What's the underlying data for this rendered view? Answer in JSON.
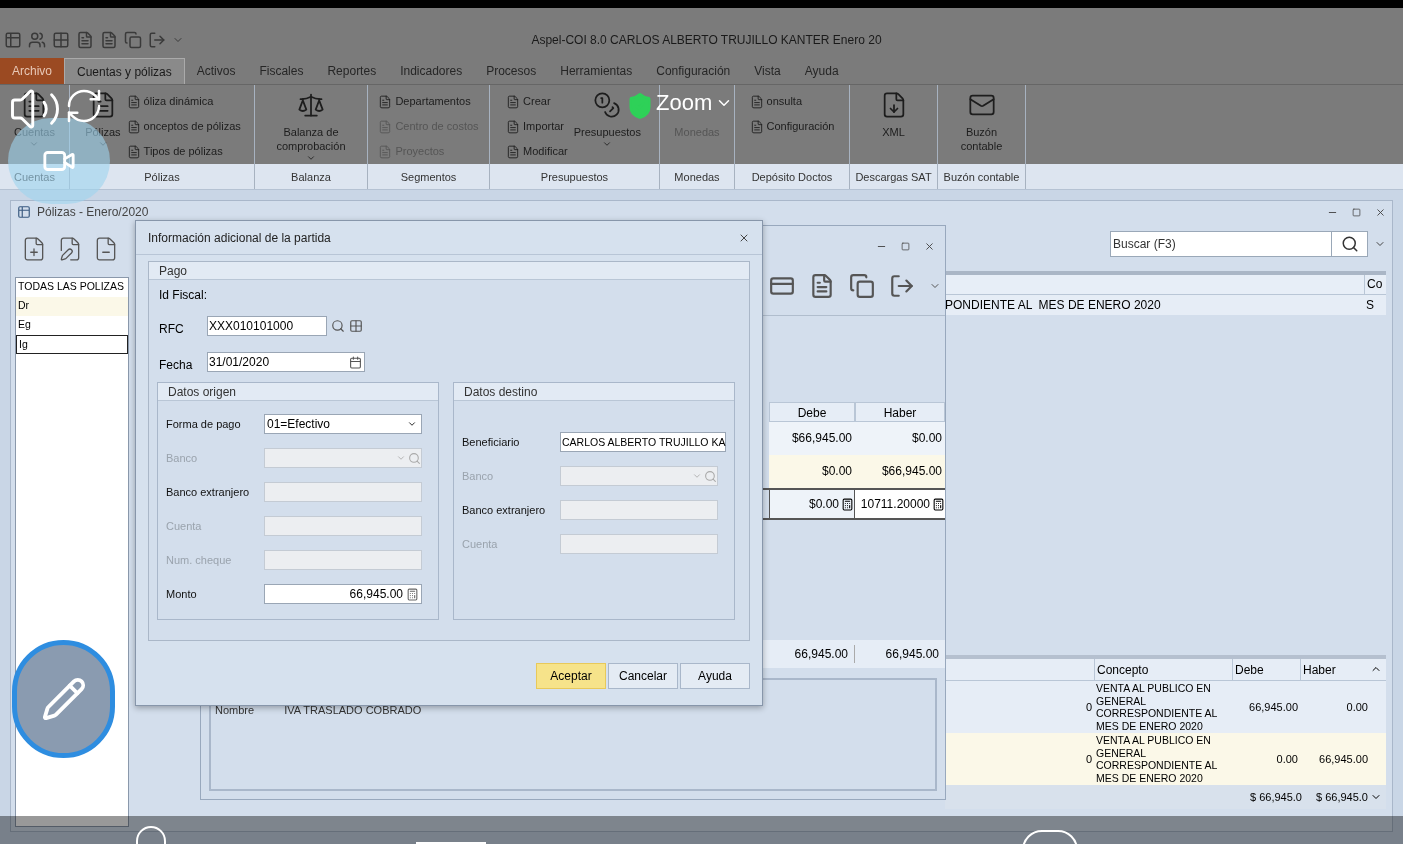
{
  "window": {
    "title": "Aspel-COI 8.0 CARLOS ALBERTO TRUJILLO KANTER Enero 20"
  },
  "menu_tabs": [
    {
      "label": "Archivo",
      "kind": "file",
      "selected": false
    },
    {
      "label": "Cuentas y pólizas",
      "kind": "tab",
      "selected": true
    },
    {
      "label": "Activos",
      "kind": "tab",
      "selected": false
    },
    {
      "label": "Fiscales",
      "kind": "tab",
      "selected": false
    },
    {
      "label": "Reportes",
      "kind": "tab",
      "selected": false
    },
    {
      "label": "Indicadores",
      "kind": "tab",
      "selected": false
    },
    {
      "label": "Procesos",
      "kind": "tab",
      "selected": false
    },
    {
      "label": "Herramientas",
      "kind": "tab",
      "selected": false
    },
    {
      "label": "Configuración",
      "kind": "tab",
      "selected": false
    },
    {
      "label": "Vista",
      "kind": "tab",
      "selected": false
    },
    {
      "label": "Ayuda",
      "kind": "tab",
      "selected": false
    }
  ],
  "ribbon_groups": [
    {
      "label": "Cuentas",
      "items": [
        {
          "label": "Cuentas",
          "kind": "large",
          "disabled": false,
          "dropdown": true
        }
      ]
    },
    {
      "label": "Pólizas",
      "items": [
        {
          "label": "Pólizas",
          "kind": "large",
          "disabled": false,
          "dropdown": true
        },
        {
          "label": "óliza dinámica",
          "kind": "small",
          "disabled": false
        },
        {
          "label": "onceptos de pólizas",
          "kind": "small",
          "disabled": false
        },
        {
          "label": "Tipos de pólizas",
          "kind": "small",
          "disabled": false
        }
      ]
    },
    {
      "label": "Balanza",
      "items": [
        {
          "label": "Balanza de comprobación",
          "kind": "large",
          "disabled": false,
          "dropdown": true
        }
      ]
    },
    {
      "label": "Segmentos",
      "items": [
        {
          "label": "Departamentos",
          "kind": "small",
          "disabled": false
        },
        {
          "label": "Centro de costos",
          "kind": "small",
          "disabled": true
        },
        {
          "label": "Proyectos",
          "kind": "small",
          "disabled": true
        }
      ]
    },
    {
      "label": "Presupuestos",
      "items": [
        {
          "label": "Crear",
          "kind": "small",
          "disabled": false
        },
        {
          "label": "Importar",
          "kind": "small",
          "disabled": false
        },
        {
          "label": "Modificar",
          "kind": "small",
          "disabled": false
        },
        {
          "label": "Presupuestos",
          "kind": "large",
          "disabled": false,
          "dropdown": true
        }
      ]
    },
    {
      "label": "Monedas",
      "items": [
        {
          "label": "Monedas",
          "kind": "large",
          "disabled": true,
          "dropdown": false
        }
      ]
    },
    {
      "label": "Depósito Doctos",
      "items": [
        {
          "label": "onsulta",
          "kind": "small",
          "disabled": false
        },
        {
          "label": "Configuración",
          "kind": "small",
          "disabled": false
        }
      ]
    },
    {
      "label": "Descargas SAT",
      "items": [
        {
          "label": "XML",
          "kind": "large",
          "disabled": false,
          "dropdown": false
        }
      ]
    },
    {
      "label": "Buzón contable",
      "items": [
        {
          "label": "Buzón contable",
          "kind": "large",
          "disabled": false,
          "dropdown": false
        }
      ]
    }
  ],
  "polizas_window": {
    "title": "Pólizas - Enero/2020",
    "types": [
      {
        "label": "TODAS LAS POLIZAS",
        "selected": false
      },
      {
        "label": "Dr",
        "selected": false
      },
      {
        "label": "Eg",
        "selected": false
      },
      {
        "label": "Ig",
        "selected": true
      }
    ],
    "search": {
      "placeholder": "Buscar (F3)"
    },
    "table": {
      "columns": [
        "Co"
      ],
      "rows": [
        {
          "concepto": "PONDIENTE AL  MES DE ENERO 2020",
          "column_2": "S"
        }
      ]
    },
    "detail_grid": {
      "columns": [
        "Concepto",
        "Debe",
        "Haber"
      ],
      "rows": [
        {
          "column_1": "0",
          "concepto": "VENTA AL PUBLICO EN GENERAL CORRESPONDIENTE AL MES DE ENERO 2020",
          "debe": "66,945.00",
          "haber": "0.00"
        },
        {
          "column_1": "0",
          "concepto": "VENTA AL PUBLICO EN GENERAL CORRESPONDIENTE AL MES DE ENERO 2020",
          "debe": "0.00",
          "haber": "66,945.00"
        }
      ],
      "totals": [
        "$ 66,945.0",
        "$ 66,945.0"
      ]
    }
  },
  "movimientos_window": {
    "columns": [
      "Debe",
      "Haber"
    ],
    "rows": [
      {
        "debe": "$66,945.00",
        "haber": "$0.00"
      },
      {
        "debe": "$0.00",
        "haber": "$66,945.00"
      }
    ],
    "edit_row": {
      "debe": "$0.00",
      "haber": "10711.20000"
    },
    "totals": {
      "debe": "66,945.00",
      "haber": "66,945.00"
    },
    "account": {
      "label": "Nombre",
      "value": "IVA TRASLADO COBRADO"
    }
  },
  "dialog": {
    "title": "Información adicional de la partida",
    "section": "Pago",
    "id_fiscal": "Id Fiscal:",
    "rfc": {
      "label": "RFC",
      "value": "XXX010101000"
    },
    "fecha": {
      "label": "Fecha",
      "value": "31/01/2020"
    },
    "origen": {
      "title": "Datos origen",
      "fields": [
        {
          "label": "Forma de pago",
          "kind": "select",
          "value": "01=Efectivo",
          "disabled": false
        },
        {
          "label": "Banco",
          "kind": "lookup",
          "disabled": true
        },
        {
          "label": "Banco extranjero",
          "kind": "text",
          "disabled": false
        },
        {
          "label": "Cuenta",
          "kind": "text",
          "disabled": true
        },
        {
          "label": "Num. cheque",
          "kind": "text",
          "disabled": true
        },
        {
          "label": "Monto",
          "kind": "amount",
          "value": "66,945.00",
          "disabled": false
        }
      ]
    },
    "destino": {
      "title": "Datos destino",
      "fields": [
        {
          "label": "Beneficiario",
          "kind": "text",
          "value": "CARLOS ALBERTO TRUJILLO KA",
          "disabled": false
        },
        {
          "label": "Banco",
          "kind": "lookup",
          "disabled": true
        },
        {
          "label": "Banco extranjero",
          "kind": "text",
          "disabled": false
        },
        {
          "label": "Cuenta",
          "kind": "text",
          "disabled": true
        }
      ]
    },
    "buttons": [
      {
        "label": "Aceptar",
        "selected": true
      },
      {
        "label": "Cancelar",
        "selected": false
      },
      {
        "label": "Ayuda",
        "selected": false
      }
    ]
  },
  "zoom_overlay": {
    "label": "Zoom"
  }
}
